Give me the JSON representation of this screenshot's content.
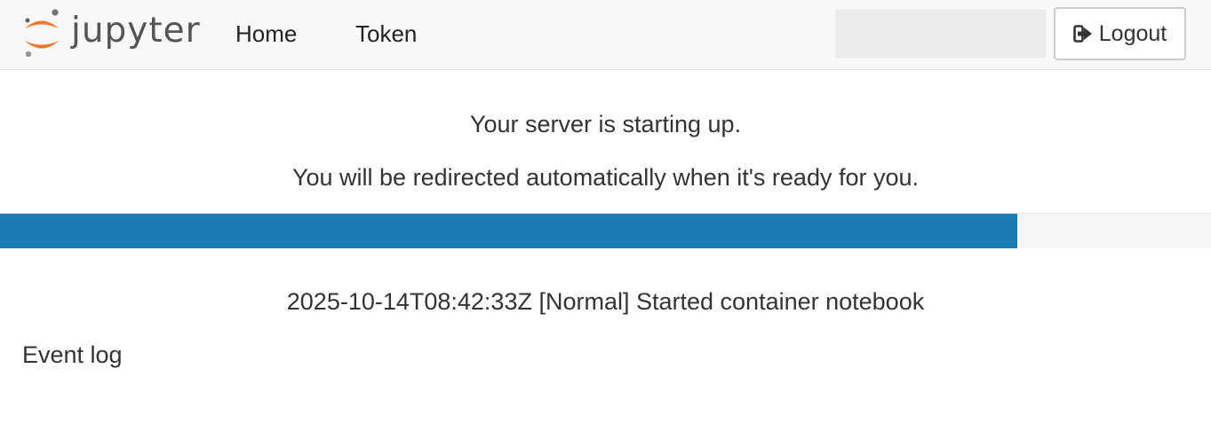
{
  "navbar": {
    "brand_name": "jupyter",
    "brand_logo_icon": "jupyter-logo",
    "links": [
      {
        "label": "Home"
      },
      {
        "label": "Token"
      }
    ],
    "user_name": "",
    "logout": {
      "label": "Logout",
      "icon": "sign-out-icon"
    }
  },
  "main": {
    "message_1": "Your server is starting up.",
    "message_2": "You will be redirected automatically when it's ready for you.",
    "progress_percent": 84,
    "progress_color": "#1a7bb5",
    "latest_event": "2025-10-14T08:42:33Z [Normal] Started container notebook",
    "event_log_label": "Event log"
  },
  "colors": {
    "logo_orange": "#f37726",
    "logo_gray": "#767677",
    "navbar_bg": "#f8f8f8"
  }
}
